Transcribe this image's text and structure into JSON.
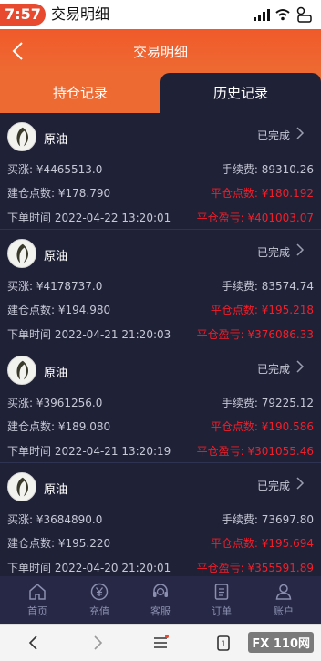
{
  "status_bar": {
    "time": "7:57",
    "title": "交易明细"
  },
  "header": {
    "title": "交易明细"
  },
  "tabs": [
    {
      "label": "持仓记录",
      "active": false
    },
    {
      "label": "历史记录",
      "active": true
    }
  ],
  "records": [
    {
      "product": "原油",
      "status": "已完成",
      "buy_up": "买涨: ¥4465513.0",
      "fee": "手续费: 89310.26",
      "open_point": "建仓点数: ¥178.790",
      "close_point": "平仓点数: ¥180.192",
      "order_time": "下单时间 2022-04-22 13:20:01",
      "pnl": "平仓盈亏: ¥401003.07"
    },
    {
      "product": "原油",
      "status": "已完成",
      "buy_up": "买涨: ¥4178737.0",
      "fee": "手续费: 83574.74",
      "open_point": "建仓点数: ¥194.980",
      "close_point": "平仓点数: ¥195.218",
      "order_time": "下单时间 2022-04-21 21:20:03",
      "pnl": "平仓盈亏: ¥376086.33"
    },
    {
      "product": "原油",
      "status": "已完成",
      "buy_up": "买涨: ¥3961256.0",
      "fee": "手续费: 79225.12",
      "open_point": "建仓点数: ¥189.080",
      "close_point": "平仓点数: ¥190.586",
      "order_time": "下单时间 2022-04-21 13:20:19",
      "pnl": "平仓盈亏: ¥301055.46"
    },
    {
      "product": "原油",
      "status": "已完成",
      "buy_up": "买涨: ¥3684890.0",
      "fee": "手续费: 73697.80",
      "open_point": "建仓点数: ¥195.220",
      "close_point": "平仓点数: ¥195.694",
      "order_time": "下单时间 2022-04-20 21:20:01",
      "pnl": "平仓盈亏: ¥355591.89"
    }
  ],
  "tabbar": [
    {
      "label": "首页",
      "icon": "home-icon"
    },
    {
      "label": "充值",
      "icon": "yen-icon"
    },
    {
      "label": "客服",
      "icon": "service-icon"
    },
    {
      "label": "订单",
      "icon": "order-icon"
    },
    {
      "label": "账户",
      "icon": "user-icon"
    }
  ],
  "watermark": "FX 110网",
  "colors": {
    "accent": "#ee6a33",
    "background": "#1f2136",
    "loss_red": "#f21f2a",
    "tabbar": "#262845"
  }
}
